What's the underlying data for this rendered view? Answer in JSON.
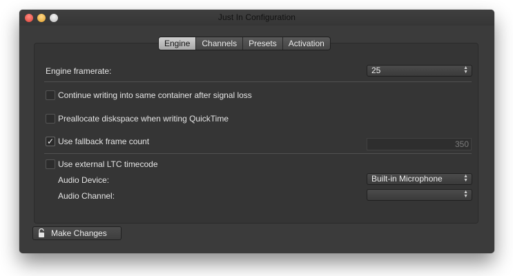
{
  "window": {
    "title": "Just In Configuration"
  },
  "tabs": [
    {
      "label": "Engine",
      "active": true
    },
    {
      "label": "Channels",
      "active": false
    },
    {
      "label": "Presets",
      "active": false
    },
    {
      "label": "Activation",
      "active": false
    }
  ],
  "engine": {
    "framerate_label": "Engine framerate:",
    "framerate_value": "25",
    "continue_writing_label": "Continue writing into same container after signal loss",
    "continue_writing_checked": false,
    "preallocate_label": "Preallocate diskspace when writing QuickTime",
    "preallocate_checked": false,
    "fallback_label": "Use fallback frame count",
    "fallback_checked": true,
    "fallback_value": "350",
    "ltc_label": "Use external LTC timecode",
    "ltc_checked": false,
    "audio_device_label": "Audio Device:",
    "audio_device_value": "Built-in Microphone",
    "audio_channel_label": "Audio Channel:",
    "audio_channel_value": ""
  },
  "footer": {
    "make_changes_label": "Make Changes"
  },
  "icons": {
    "check": "✓",
    "lock": "unlocked-padlock-icon"
  }
}
